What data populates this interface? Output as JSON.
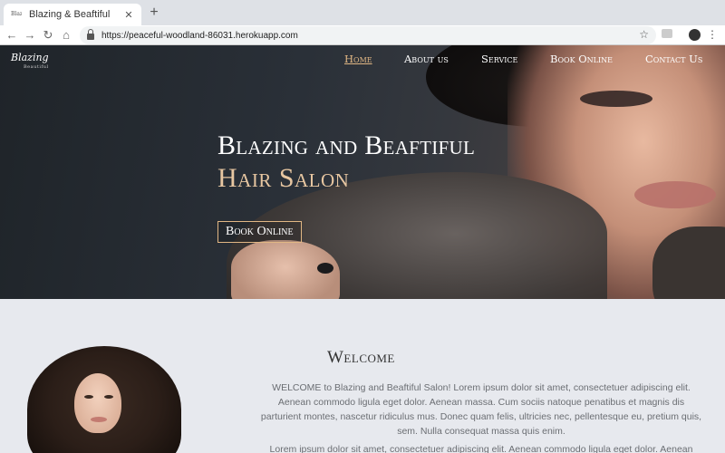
{
  "browser": {
    "tab_title": "Blazing & Beaftiful",
    "tab_favicon_text": "Blazing",
    "url": "https://peaceful-woodland-86031.herokuapp.com"
  },
  "site": {
    "brand": "Blazing",
    "brand_sub": "Beautiful",
    "nav": [
      {
        "label": "Home",
        "active": true
      },
      {
        "label": "About us",
        "active": false
      },
      {
        "label": "Service",
        "active": false
      },
      {
        "label": "Book Online",
        "active": false
      },
      {
        "label": "Contact Us",
        "active": false
      }
    ],
    "hero": {
      "title_line1": "Blazing and Beaftiful",
      "title_line2": "Hair Salon",
      "cta": "Book Online"
    },
    "welcome": {
      "title": "Welcome",
      "paragraph1": "WELCOME to Blazing and Beaftiful Salon! Lorem ipsum dolor sit amet, consectetuer adipiscing elit. Aenean commodo ligula eget dolor. Aenean massa. Cum sociis natoque penatibus et magnis dis parturient montes, nascetur ridiculus mus. Donec quam felis, ultricies nec, pellentesque eu, pretium quis, sem. Nulla consequat massa quis enim.",
      "paragraph2": "Lorem ipsum dolor sit amet, consectetuer adipiscing elit. Aenean commodo ligula eget dolor. Aenean"
    }
  },
  "colors": {
    "accent_gold": "#e1b784",
    "hero_title_gold": "#e7c6a1",
    "page_bg": "#e7e9ee"
  }
}
